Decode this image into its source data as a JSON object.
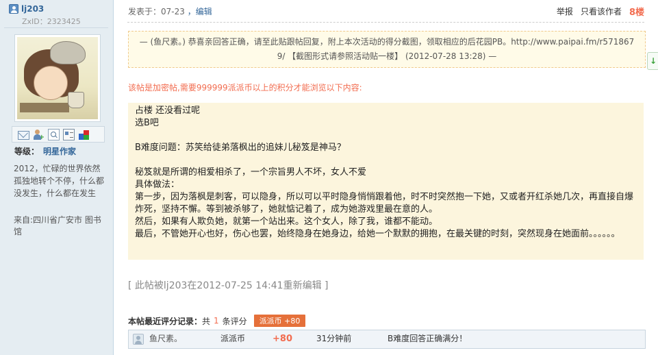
{
  "user": {
    "name": "lj203",
    "zxid": "ZxID：2323425",
    "level_label": "等级：",
    "level_value": "明星作家",
    "signature": "2012，忙碌的世界依然孤独地转个不停，什么都没发生，什么都在发生",
    "location": "来自:四川省广安市 图书馆",
    "icons": [
      "mail-icon",
      "add-friend-icon",
      "search-icon",
      "profile-card-icon",
      "medal-icon"
    ]
  },
  "post": {
    "posted_at": "发表于：07-23",
    "edit_label": "，编辑",
    "report_label": "举报",
    "author_only_label": "只看该作者",
    "floor": "8楼",
    "quote": "— (鱼尺素。) 恭喜亲回答正确，请至此贴跟帖回复，附上本次活动的得分截图，领取相应的后花园PB。http://www.paipai.fm/r5718679/  【截图形式请参照活动贴一楼】 (2012-07-28 13:28) —",
    "lock_notice": "该帖是加密帖,需要999999派派币以上的积分才能浏览以下内容:",
    "content_lines": [
      "占楼 还没看过呢",
      "选B吧",
      "",
      "B难度问题：苏笑给徒弟落枫出的追妹儿秘笈是神马？",
      "",
      "秘笈就是所谓的相爱相杀了，一个宗旨男人不坏，女人不爱",
      "具体做法：",
      "第一步，因为落枫是刺客，可以隐身，所以可以平时隐身悄悄跟着他，时不时突然抱一下她，又或者开红杀她几次，再直接自爆炸死，坚持不懈。等到被杀够了，她就惦记着了，成为她游戏里最在意的人。",
      "然后，如果有人欺负她，就第一个站出来。这个女人，除了我，谁都不能动。",
      "最后，不管她开心也好，伤心也罢，始终隐身在她身边，给她一个默默的拥抱，在最关键的时刻，突然现身在她面前。。。。。。"
    ],
    "edited_note": "[ 此帖被lj203在2012-07-25 14:41重新编辑 ]"
  },
  "rating": {
    "title": "本帖最近评分记录：",
    "count_prefix": "共",
    "count": "1",
    "count_suffix": "条评分",
    "badge": "派派币 +80",
    "rows": [
      {
        "user": "鱼尺素。",
        "type": "派派币",
        "score": "+80",
        "time": "31分钟前",
        "reason": "B难度回答正确满分！"
      }
    ]
  },
  "side_button": "↓",
  "colors": {
    "sidebar_bg": "#e5edf2",
    "accent_orange": "#f26c4f",
    "link_blue": "#336699",
    "content_bg": "#fcf5dd",
    "quote_bg": "#fffbe8"
  }
}
